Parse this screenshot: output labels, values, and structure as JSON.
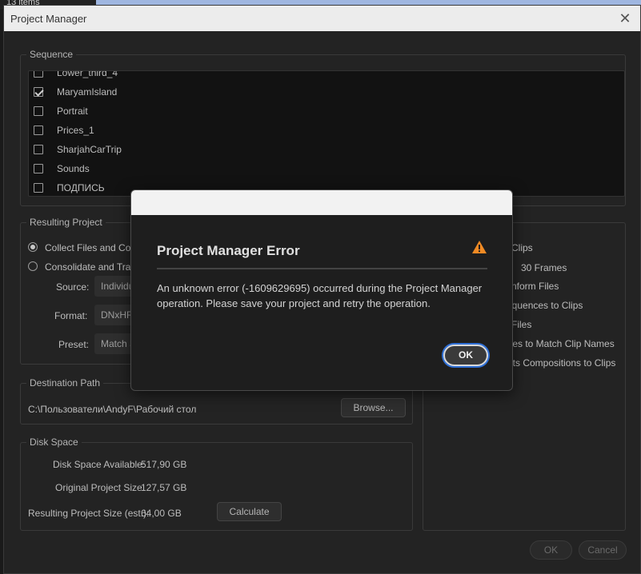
{
  "background": {
    "items_label": "13 items"
  },
  "window": {
    "title": "Project Manager",
    "close_glyph": "✕"
  },
  "sequence": {
    "legend": "Sequence",
    "items": [
      {
        "label": "Lower_third_4",
        "checked": false
      },
      {
        "label": "MaryamIsland",
        "checked": true
      },
      {
        "label": "Portrait",
        "checked": false
      },
      {
        "label": "Prices_1",
        "checked": false
      },
      {
        "label": "SharjahCarTrip",
        "checked": false
      },
      {
        "label": "Sounds",
        "checked": false
      },
      {
        "label": "ПОДПИСЬ",
        "checked": false
      }
    ]
  },
  "resulting_project": {
    "legend": "Resulting Project",
    "option_collect": "Collect Files and Copy",
    "option_consolidate": "Consolidate and Trans",
    "source_label": "Source:",
    "source_value": "Individu",
    "format_label": "Format:",
    "format_value": "DNxHR",
    "preset_label": "Preset:",
    "preset_value": "Match S"
  },
  "options_right": {
    "clips": "Clips",
    "frames": "30 Frames",
    "conform": "nform Files",
    "sequences": "equences to Clips",
    "files": "Files",
    "match_names": "iles to Match Clip Names",
    "compositions": "ects Compositions to Clips"
  },
  "destination": {
    "legend": "Destination Path",
    "path": "C:\\Пользователи\\AndyF\\Рабочий стол",
    "browse_label": "Browse..."
  },
  "disk_space": {
    "legend": "Disk Space",
    "available_label": "Disk Space Available:",
    "available_value": "517,90 GB",
    "original_label": "Original Project Size:",
    "original_value": "127,57 GB",
    "resulting_label": "Resulting Project Size (est.):",
    "resulting_value": "64,00 GB",
    "calculate_label": "Calculate"
  },
  "footer": {
    "ok_label": "OK",
    "cancel_label": "Cancel"
  },
  "error_dialog": {
    "title": "Project Manager Error",
    "message": "An unknown error (-1609629695) occurred during the Project Manager operation. Please save your project and retry the operation.",
    "ok_label": "OK",
    "icon": "warning-icon",
    "icon_color": "#f08a24"
  }
}
